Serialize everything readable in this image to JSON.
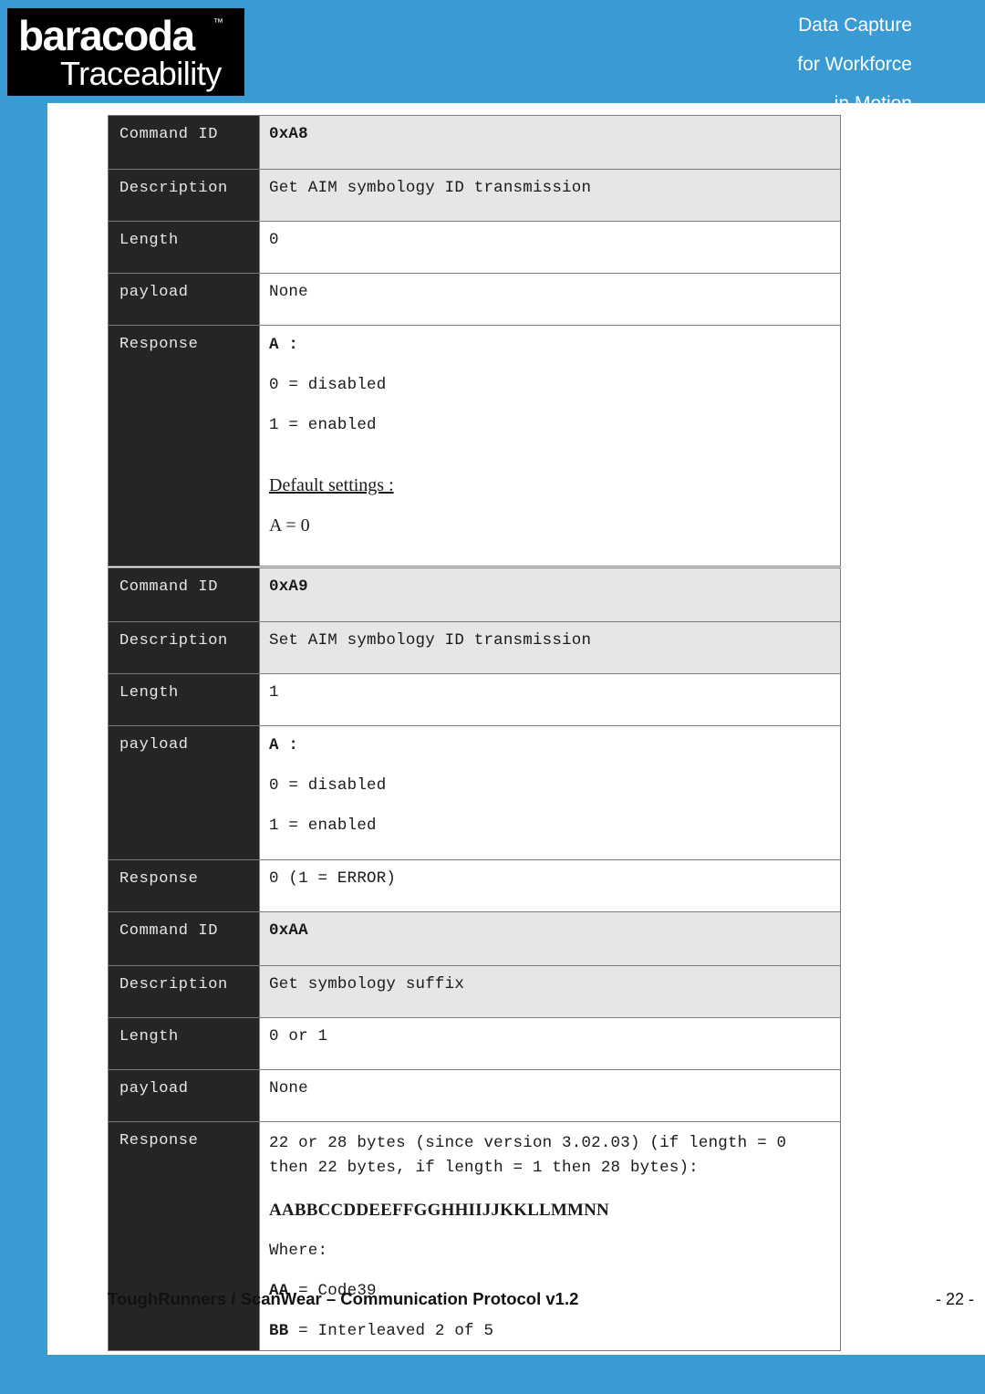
{
  "theme": {
    "accent": "#3a9ad4",
    "label_bg": "#252525",
    "shaded_bg": "#e6e6e6",
    "logo_bg": "#000000"
  },
  "header": {
    "logo": {
      "word": "baracoda",
      "tm": "™",
      "sub": "Traceability"
    },
    "tagline": [
      "Data Capture",
      "for Workforce",
      "in Motion"
    ]
  },
  "tables": [
    {
      "id": "0xA8",
      "rows": {
        "command_id": {
          "label": "Command ID",
          "value": "0xA8"
        },
        "description": {
          "label": "Description",
          "value": "Get AIM symbology ID transmission"
        },
        "length": {
          "label": "Length",
          "value": "0"
        },
        "payload": {
          "label": "payload",
          "value": "None"
        },
        "response": {
          "label": "Response",
          "lines": {
            "a": "A :",
            "disabled": "0 = disabled",
            "enabled": "1 = enabled",
            "default_heading": "Default settings :",
            "default_value": "A = 0"
          }
        }
      }
    },
    {
      "id": "0xA9",
      "rows": {
        "command_id": {
          "label": "Command ID",
          "value": "0xA9"
        },
        "description": {
          "label": "Description",
          "value": "Set AIM symbology ID transmission"
        },
        "length": {
          "label": "Length",
          "value": "1"
        },
        "payload": {
          "label": "payload",
          "lines": {
            "a": "A :",
            "disabled": "0 = disabled",
            "enabled": "1 = enabled"
          }
        },
        "response": {
          "label": "Response",
          "value": "0 (1 = ERROR)"
        }
      }
    },
    {
      "id": "0xAA",
      "rows": {
        "command_id": {
          "label": "Command ID",
          "value": "0xAA"
        },
        "description": {
          "label": "Description",
          "value": "Get symbology suffix"
        },
        "length": {
          "label": "Length",
          "value": "0 or 1"
        },
        "payload": {
          "label": "payload",
          "value": "None"
        },
        "response": {
          "label": "Response",
          "lines": {
            "intro": "22 or 28 bytes  (since version 3.02.03) (if length = 0 then 22 bytes, if length = 1 then 28 bytes):",
            "pattern": "AABBCCDDEEFFGGHHIIJJKKLLMMNN",
            "where": "Where:",
            "aa_code": "AA",
            "aa_value": " = Code39",
            "bb_code": "BB",
            "bb_value": " = Interleaved 2 of 5"
          }
        }
      }
    }
  ],
  "footer": {
    "title": "ToughRunners / ScanWear – Communication Protocol v1.2",
    "page": "- 22 -"
  }
}
